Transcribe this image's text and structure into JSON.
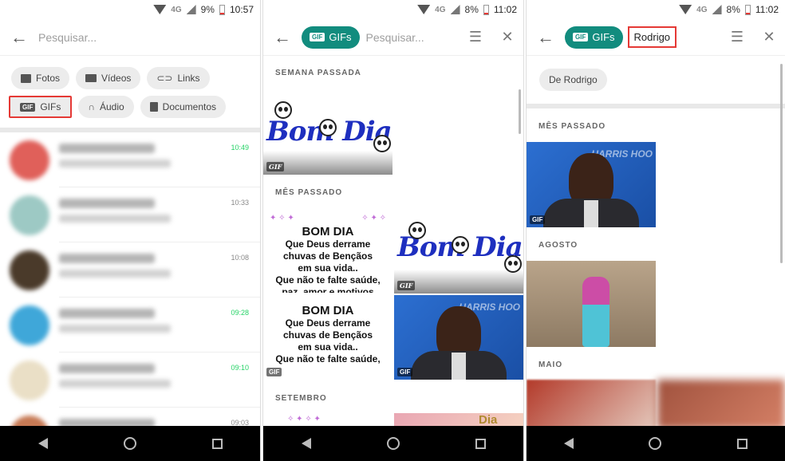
{
  "panels": [
    {
      "status": {
        "network": "4G",
        "battery": "9%",
        "time": "10:57"
      },
      "search_placeholder": "Pesquisar...",
      "chips": [
        {
          "label": "Fotos",
          "icon": "image-icon"
        },
        {
          "label": "Vídeos",
          "icon": "video-icon"
        },
        {
          "label": "Links",
          "icon": "link-icon"
        },
        {
          "label": "GIFs",
          "icon": "gif-icon",
          "highlighted": true
        },
        {
          "label": "Áudio",
          "icon": "headphones-icon"
        },
        {
          "label": "Documentos",
          "icon": "document-icon"
        }
      ],
      "chats": [
        {
          "time": "10:49",
          "unread": true
        },
        {
          "time": "10:33",
          "unread": false
        },
        {
          "time": "10:08",
          "unread": false
        },
        {
          "time": "09:28",
          "unread": true
        },
        {
          "time": "09:10",
          "unread": true
        },
        {
          "time": "09:03",
          "unread": false
        }
      ]
    },
    {
      "status": {
        "network": "4G",
        "battery": "8%",
        "time": "11:02"
      },
      "filter_pill": {
        "badge": "GIF",
        "label": "GIFs"
      },
      "search_placeholder": "Pesquisar...",
      "sections": [
        "SEMANA PASSADA",
        "MÊS PASSADO",
        "SETEMBRO"
      ],
      "gif_tag": "GIF",
      "bomdia_text": "Bom Dia",
      "poem": {
        "heading": "BOM DIA",
        "lines": [
          "Que Deus derrame",
          "chuvas de Bençãos",
          "em sua vida..",
          "Que não te falte saúde,",
          "paz, amor e motivos"
        ]
      },
      "brand_text": "HARRIS HOO",
      "dia_text": "Dia"
    },
    {
      "status": {
        "network": "4G",
        "battery": "8%",
        "time": "11:02"
      },
      "filter_pill": {
        "badge": "GIF",
        "label": "GIFs"
      },
      "query": "Rodrigo",
      "sender_chip": "De Rodrigo",
      "sections": [
        "MÊS PASSADO",
        "AGOSTO",
        "MAIO"
      ],
      "gif_tag": "GIF",
      "brand_text": "HARRIS HOO"
    }
  ]
}
